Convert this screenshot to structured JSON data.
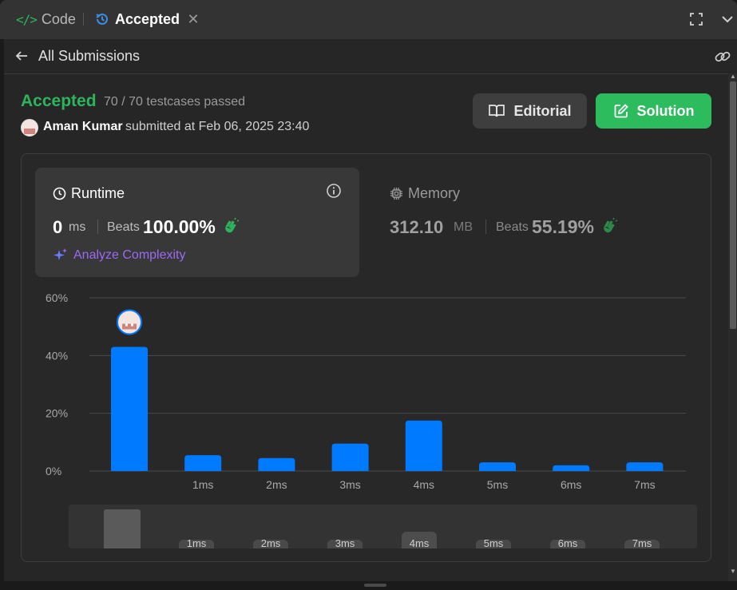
{
  "tabs": {
    "code_label": "Code",
    "code_icon": "</>",
    "accepted_label": "Accepted",
    "close_glyph": "✕"
  },
  "subheader": {
    "title": "All Submissions"
  },
  "submission": {
    "status": "Accepted",
    "testcases": "70 / 70 testcases passed",
    "author": "Aman Kumar",
    "submitted_text": "submitted at Feb 06, 2025 23:40"
  },
  "buttons": {
    "editorial": "Editorial",
    "solution": "Solution"
  },
  "runtime": {
    "label": "Runtime",
    "value": "0",
    "unit": "ms",
    "beats_label": "Beats",
    "beats_value": "100.00%",
    "analyze_label": "Analyze Complexity"
  },
  "memory": {
    "label": "Memory",
    "value": "312.10",
    "unit": "MB",
    "beats_label": "Beats",
    "beats_value": "55.19%"
  },
  "colors": {
    "accent_green": "#2cbb5d",
    "bar_blue": "#007aff",
    "analyze_purple": "#9b6af5"
  },
  "chart_data": {
    "type": "bar",
    "categories": [
      "0ms",
      "1ms",
      "2ms",
      "3ms",
      "4ms",
      "5ms",
      "6ms",
      "7ms"
    ],
    "tick_labels": [
      "",
      "1ms",
      "2ms",
      "3ms",
      "4ms",
      "5ms",
      "6ms",
      "7ms"
    ],
    "values": [
      43,
      5.5,
      4.5,
      9.5,
      17.5,
      3,
      2,
      3
    ],
    "y_ticks": [
      "0%",
      "20%",
      "40%",
      "60%"
    ],
    "ylim": [
      0,
      60
    ],
    "highlight_index": 0,
    "grid": true,
    "minimap": {
      "tick_labels": [
        "1ms",
        "2ms",
        "3ms",
        "4ms",
        "5ms",
        "6ms",
        "7ms"
      ]
    }
  }
}
